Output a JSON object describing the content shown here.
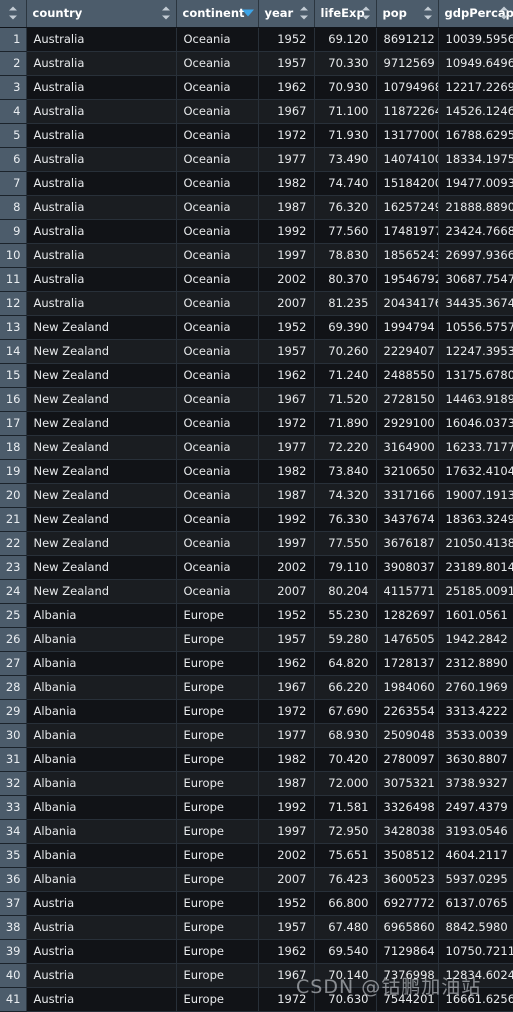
{
  "table": {
    "columns": [
      {
        "key": "rownum",
        "label": "",
        "sort": "both",
        "align": "right"
      },
      {
        "key": "country",
        "label": "country",
        "sort": "both",
        "align": "left"
      },
      {
        "key": "continent",
        "label": "continent",
        "sort": "desc-active",
        "align": "left"
      },
      {
        "key": "year",
        "label": "year",
        "sort": "both",
        "align": "right"
      },
      {
        "key": "lifeExp",
        "label": "lifeExp",
        "sort": "both",
        "align": "right"
      },
      {
        "key": "pop",
        "label": "pop",
        "sort": "both",
        "align": "right"
      },
      {
        "key": "gdpPercap",
        "label": "gdpPercap",
        "sort": "both",
        "align": "right"
      }
    ],
    "sorted_by": "continent",
    "sort_direction": "descending",
    "accent_color": "#3da5e8",
    "header_bg": "#4c5c6b",
    "row_bg": "#111317",
    "row_bg_alt": "#1a1d21",
    "rows": [
      {
        "n": "1",
        "country": "Australia",
        "continent": "Oceania",
        "year": "1952",
        "lifeExp": "69.120",
        "pop": "8691212",
        "gdpPercap": "10039.5956"
      },
      {
        "n": "2",
        "country": "Australia",
        "continent": "Oceania",
        "year": "1957",
        "lifeExp": "70.330",
        "pop": "9712569",
        "gdpPercap": "10949.6496"
      },
      {
        "n": "3",
        "country": "Australia",
        "continent": "Oceania",
        "year": "1962",
        "lifeExp": "70.930",
        "pop": "10794968",
        "gdpPercap": "12217.2269"
      },
      {
        "n": "4",
        "country": "Australia",
        "continent": "Oceania",
        "year": "1967",
        "lifeExp": "71.100",
        "pop": "11872264",
        "gdpPercap": "14526.1246"
      },
      {
        "n": "5",
        "country": "Australia",
        "continent": "Oceania",
        "year": "1972",
        "lifeExp": "71.930",
        "pop": "13177000",
        "gdpPercap": "16788.6295"
      },
      {
        "n": "6",
        "country": "Australia",
        "continent": "Oceania",
        "year": "1977",
        "lifeExp": "73.490",
        "pop": "14074100",
        "gdpPercap": "18334.1975"
      },
      {
        "n": "7",
        "country": "Australia",
        "continent": "Oceania",
        "year": "1982",
        "lifeExp": "74.740",
        "pop": "15184200",
        "gdpPercap": "19477.0093"
      },
      {
        "n": "8",
        "country": "Australia",
        "continent": "Oceania",
        "year": "1987",
        "lifeExp": "76.320",
        "pop": "16257249",
        "gdpPercap": "21888.8890"
      },
      {
        "n": "9",
        "country": "Australia",
        "continent": "Oceania",
        "year": "1992",
        "lifeExp": "77.560",
        "pop": "17481977",
        "gdpPercap": "23424.7668"
      },
      {
        "n": "10",
        "country": "Australia",
        "continent": "Oceania",
        "year": "1997",
        "lifeExp": "78.830",
        "pop": "18565243",
        "gdpPercap": "26997.9366"
      },
      {
        "n": "11",
        "country": "Australia",
        "continent": "Oceania",
        "year": "2002",
        "lifeExp": "80.370",
        "pop": "19546792",
        "gdpPercap": "30687.7547"
      },
      {
        "n": "12",
        "country": "Australia",
        "continent": "Oceania",
        "year": "2007",
        "lifeExp": "81.235",
        "pop": "20434176",
        "gdpPercap": "34435.3674"
      },
      {
        "n": "13",
        "country": "New Zealand",
        "continent": "Oceania",
        "year": "1952",
        "lifeExp": "69.390",
        "pop": "1994794",
        "gdpPercap": "10556.5757"
      },
      {
        "n": "14",
        "country": "New Zealand",
        "continent": "Oceania",
        "year": "1957",
        "lifeExp": "70.260",
        "pop": "2229407",
        "gdpPercap": "12247.3953"
      },
      {
        "n": "15",
        "country": "New Zealand",
        "continent": "Oceania",
        "year": "1962",
        "lifeExp": "71.240",
        "pop": "2488550",
        "gdpPercap": "13175.6780"
      },
      {
        "n": "16",
        "country": "New Zealand",
        "continent": "Oceania",
        "year": "1967",
        "lifeExp": "71.520",
        "pop": "2728150",
        "gdpPercap": "14463.9189"
      },
      {
        "n": "17",
        "country": "New Zealand",
        "continent": "Oceania",
        "year": "1972",
        "lifeExp": "71.890",
        "pop": "2929100",
        "gdpPercap": "16046.0373"
      },
      {
        "n": "18",
        "country": "New Zealand",
        "continent": "Oceania",
        "year": "1977",
        "lifeExp": "72.220",
        "pop": "3164900",
        "gdpPercap": "16233.7177"
      },
      {
        "n": "19",
        "country": "New Zealand",
        "continent": "Oceania",
        "year": "1982",
        "lifeExp": "73.840",
        "pop": "3210650",
        "gdpPercap": "17632.4104"
      },
      {
        "n": "20",
        "country": "New Zealand",
        "continent": "Oceania",
        "year": "1987",
        "lifeExp": "74.320",
        "pop": "3317166",
        "gdpPercap": "19007.1913"
      },
      {
        "n": "21",
        "country": "New Zealand",
        "continent": "Oceania",
        "year": "1992",
        "lifeExp": "76.330",
        "pop": "3437674",
        "gdpPercap": "18363.3249"
      },
      {
        "n": "22",
        "country": "New Zealand",
        "continent": "Oceania",
        "year": "1997",
        "lifeExp": "77.550",
        "pop": "3676187",
        "gdpPercap": "21050.4138"
      },
      {
        "n": "23",
        "country": "New Zealand",
        "continent": "Oceania",
        "year": "2002",
        "lifeExp": "79.110",
        "pop": "3908037",
        "gdpPercap": "23189.8014"
      },
      {
        "n": "24",
        "country": "New Zealand",
        "continent": "Oceania",
        "year": "2007",
        "lifeExp": "80.204",
        "pop": "4115771",
        "gdpPercap": "25185.0091"
      },
      {
        "n": "25",
        "country": "Albania",
        "continent": "Europe",
        "year": "1952",
        "lifeExp": "55.230",
        "pop": "1282697",
        "gdpPercap": "1601.0561"
      },
      {
        "n": "26",
        "country": "Albania",
        "continent": "Europe",
        "year": "1957",
        "lifeExp": "59.280",
        "pop": "1476505",
        "gdpPercap": "1942.2842"
      },
      {
        "n": "27",
        "country": "Albania",
        "continent": "Europe",
        "year": "1962",
        "lifeExp": "64.820",
        "pop": "1728137",
        "gdpPercap": "2312.8890"
      },
      {
        "n": "28",
        "country": "Albania",
        "continent": "Europe",
        "year": "1967",
        "lifeExp": "66.220",
        "pop": "1984060",
        "gdpPercap": "2760.1969"
      },
      {
        "n": "29",
        "country": "Albania",
        "continent": "Europe",
        "year": "1972",
        "lifeExp": "67.690",
        "pop": "2263554",
        "gdpPercap": "3313.4222"
      },
      {
        "n": "30",
        "country": "Albania",
        "continent": "Europe",
        "year": "1977",
        "lifeExp": "68.930",
        "pop": "2509048",
        "gdpPercap": "3533.0039"
      },
      {
        "n": "31",
        "country": "Albania",
        "continent": "Europe",
        "year": "1982",
        "lifeExp": "70.420",
        "pop": "2780097",
        "gdpPercap": "3630.8807"
      },
      {
        "n": "32",
        "country": "Albania",
        "continent": "Europe",
        "year": "1987",
        "lifeExp": "72.000",
        "pop": "3075321",
        "gdpPercap": "3738.9327"
      },
      {
        "n": "33",
        "country": "Albania",
        "continent": "Europe",
        "year": "1992",
        "lifeExp": "71.581",
        "pop": "3326498",
        "gdpPercap": "2497.4379"
      },
      {
        "n": "34",
        "country": "Albania",
        "continent": "Europe",
        "year": "1997",
        "lifeExp": "72.950",
        "pop": "3428038",
        "gdpPercap": "3193.0546"
      },
      {
        "n": "35",
        "country": "Albania",
        "continent": "Europe",
        "year": "2002",
        "lifeExp": "75.651",
        "pop": "3508512",
        "gdpPercap": "4604.2117"
      },
      {
        "n": "36",
        "country": "Albania",
        "continent": "Europe",
        "year": "2007",
        "lifeExp": "76.423",
        "pop": "3600523",
        "gdpPercap": "5937.0295"
      },
      {
        "n": "37",
        "country": "Austria",
        "continent": "Europe",
        "year": "1952",
        "lifeExp": "66.800",
        "pop": "6927772",
        "gdpPercap": "6137.0765"
      },
      {
        "n": "38",
        "country": "Austria",
        "continent": "Europe",
        "year": "1957",
        "lifeExp": "67.480",
        "pop": "6965860",
        "gdpPercap": "8842.5980"
      },
      {
        "n": "39",
        "country": "Austria",
        "continent": "Europe",
        "year": "1962",
        "lifeExp": "69.540",
        "pop": "7129864",
        "gdpPercap": "10750.7211"
      },
      {
        "n": "40",
        "country": "Austria",
        "continent": "Europe",
        "year": "1967",
        "lifeExp": "70.140",
        "pop": "7376998",
        "gdpPercap": "12834.6024"
      },
      {
        "n": "41",
        "country": "Austria",
        "continent": "Europe",
        "year": "1972",
        "lifeExp": "70.630",
        "pop": "7544201",
        "gdpPercap": "16661.6256"
      }
    ]
  },
  "watermark": {
    "text": "CSDN @钴鹏加油站"
  }
}
